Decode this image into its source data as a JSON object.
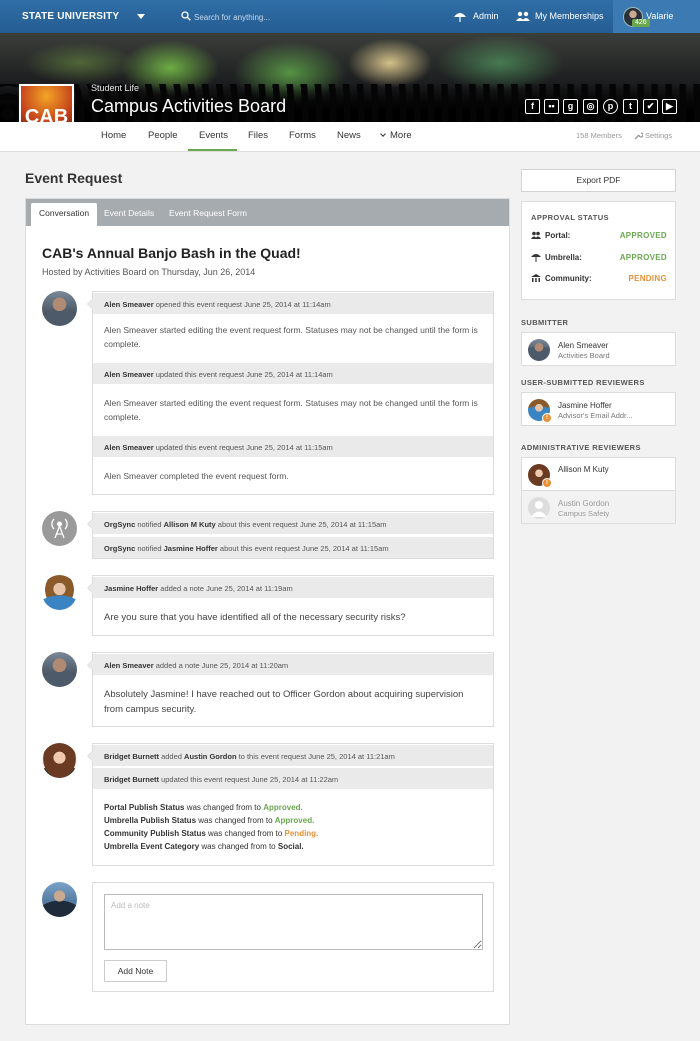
{
  "topbar": {
    "brand": "STATE UNIVERSITY",
    "search_placeholder": "Search for anything...",
    "admin": "Admin",
    "memberships": "My Memberships",
    "user_name": "Valarie",
    "user_badge": "426"
  },
  "org": {
    "logo_text": "CAB",
    "category": "Student Life",
    "name": "Campus Activities Board",
    "social_icons": [
      "facebook-icon",
      "flickr-icon",
      "google-plus-icon",
      "instagram-icon",
      "pinterest-icon",
      "tumblr-icon",
      "twitter-icon",
      "youtube-icon"
    ]
  },
  "subnav": {
    "items": [
      "Home",
      "People",
      "Events",
      "Files",
      "Forms",
      "News",
      "More"
    ],
    "active": "Events",
    "members": "158 Members",
    "settings": "Settings"
  },
  "page": {
    "title": "Event Request"
  },
  "tabs": [
    "Conversation",
    "Event Details",
    "Event Request Form"
  ],
  "event": {
    "title": "CAB's Annual Banjo Bash in the Quad!",
    "hosted": "Hosted by Activities Board on Thursday, Jun 26, 2014"
  },
  "conversation": {
    "b1": {
      "h1": {
        "name": "Alen Smeaver",
        "text": " opened this event request June 25, 2014 at 11:14am"
      },
      "body1": "Alen Smeaver started editing the event request form. Statuses may not be changed until the form is complete.",
      "h2": {
        "name": "Alen Smeaver",
        "text": " updated this event request June 25, 2014 at 11:14am"
      },
      "body2": "Alen Smeaver started editing the event request form. Statuses may not be changed until the form is complete.",
      "h3": {
        "name": "Alen Smeaver",
        "text": " updated this event request June 25, 2014 at 11:15am"
      },
      "body3": "Alen Smeaver completed the event request form."
    },
    "b2": {
      "h1": {
        "actor": "OrgSync",
        "mid": " notified ",
        "target": "Allison M Kuty",
        "text": " about this event request June 25, 2014 at 11:15am"
      },
      "h2": {
        "actor": "OrgSync",
        "mid": " notified ",
        "target": "Jasmine Hoffer",
        "text": " about this event request June 25, 2014 at 11:15am"
      }
    },
    "b3": {
      "h1": {
        "name": "Jasmine Hoffer",
        "text": " added a note June 25, 2014 at 11:19am"
      },
      "body": "Are you sure that you have identified all of the necessary security risks?"
    },
    "b4": {
      "h1": {
        "name": "Alen Smeaver",
        "text": " added a note June 25, 2014 at 11:20am"
      },
      "body": "Absolutely Jasmine! I have reached out to Officer Gordon about acquiring supervision from campus security."
    },
    "b5": {
      "h1": {
        "actor": "Bridget Burnett",
        "mid": " added ",
        "target": "Austin Gordon",
        "text": " to this event request June 25, 2014 at 11:21am"
      },
      "h2": {
        "name": "Bridget Burnett",
        "text": " updated this event request June 25, 2014 at 11:22am"
      },
      "changes": [
        {
          "field": "Portal Publish Status",
          "mid": " was changed from to ",
          "value": "Approved.",
          "color": "#6aa84f"
        },
        {
          "field": "Umbrella Publish Status",
          "mid": " was changed from to ",
          "value": "Approved.",
          "color": "#6aa84f"
        },
        {
          "field": "Community Publish Status",
          "mid": " was changed from to ",
          "value": "Pending.",
          "color": "#e69138"
        },
        {
          "field": "Umbrella Event Category",
          "mid": " was changed from to ",
          "value": "Social.",
          "color": "#333333"
        }
      ]
    },
    "note": {
      "placeholder": "Add a note",
      "button": "Add Note"
    }
  },
  "sidebar": {
    "export": "Export PDF",
    "approval": {
      "title": "APPROVAL STATUS",
      "rows": [
        {
          "label": "Portal:",
          "value": "APPROVED",
          "color": "#6aa84f"
        },
        {
          "label": "Umbrella:",
          "value": "APPROVED",
          "color": "#6aa84f"
        },
        {
          "label": "Community:",
          "value": "PENDING",
          "color": "#e69138"
        }
      ]
    },
    "submitter": {
      "title": "SUBMITTER",
      "name": "Alen Smeaver",
      "sub": "Activities Board"
    },
    "user_reviewers": {
      "title": "USER-SUBMITTED REVIEWERS",
      "name": "Jasmine Hoffer",
      "sub": "Advisor's Email Addr..."
    },
    "admin_reviewers": {
      "title": "ADMINISTRATIVE REVIEWERS",
      "people": [
        {
          "name": "Allison M Kuty",
          "sub": ""
        },
        {
          "name": "Austin Gordon",
          "sub": "Campus Safety"
        }
      ]
    }
  },
  "colors": {
    "topbar": "#2b6aa3",
    "accent_green": "#6aa84f",
    "pending_orange": "#e69138"
  }
}
